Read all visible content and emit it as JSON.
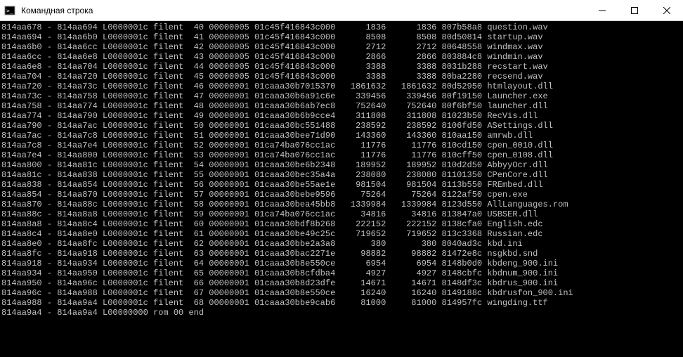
{
  "window": {
    "title": "Командная строка"
  },
  "columns": [
    "addr1",
    "sep",
    "addr2",
    "lval",
    "type",
    "n",
    "col6",
    "hash",
    "size1",
    "size2",
    "hex",
    "file"
  ],
  "rows": [
    {
      "addr1": "814aa678",
      "sep": "-",
      "addr2": "814aa694",
      "lval": "L0000001c",
      "type": "filent",
      "n": "40",
      "col6": "00000005",
      "hash": "01c45f416843c000",
      "size1": "1836",
      "size2": "1836",
      "hex": "807b58a8",
      "file": "question.wav"
    },
    {
      "addr1": "814aa694",
      "sep": "-",
      "addr2": "814aa6b0",
      "lval": "L0000001c",
      "type": "filent",
      "n": "41",
      "col6": "00000005",
      "hash": "01c45f416843c000",
      "size1": "8508",
      "size2": "8508",
      "hex": "80d50814",
      "file": "startup.wav"
    },
    {
      "addr1": "814aa6b0",
      "sep": "-",
      "addr2": "814aa6cc",
      "lval": "L0000001c",
      "type": "filent",
      "n": "42",
      "col6": "00000005",
      "hash": "01c45f416843c000",
      "size1": "2712",
      "size2": "2712",
      "hex": "80648558",
      "file": "windmax.wav"
    },
    {
      "addr1": "814aa6cc",
      "sep": "-",
      "addr2": "814aa6e8",
      "lval": "L0000001c",
      "type": "filent",
      "n": "43",
      "col6": "00000005",
      "hash": "01c45f416843c000",
      "size1": "2866",
      "size2": "2866",
      "hex": "803884c8",
      "file": "windmin.wav"
    },
    {
      "addr1": "814aa6e8",
      "sep": "-",
      "addr2": "814aa704",
      "lval": "L0000001c",
      "type": "filent",
      "n": "44",
      "col6": "00000005",
      "hash": "01c45f416843c000",
      "size1": "3388",
      "size2": "3388",
      "hex": "8031b288",
      "file": "recstart.wav"
    },
    {
      "addr1": "814aa704",
      "sep": "-",
      "addr2": "814aa720",
      "lval": "L0000001c",
      "type": "filent",
      "n": "45",
      "col6": "00000005",
      "hash": "01c45f416843c000",
      "size1": "3388",
      "size2": "3388",
      "hex": "80ba2280",
      "file": "recsend.wav"
    },
    {
      "addr1": "814aa720",
      "sep": "-",
      "addr2": "814aa73c",
      "lval": "L0000001c",
      "type": "filent",
      "n": "46",
      "col6": "00000001",
      "hash": "01caaa30b7015370",
      "size1": "1861632",
      "size2": "1861632",
      "hex": "80d52950",
      "file": "htmlayout.dll"
    },
    {
      "addr1": "814aa73c",
      "sep": "-",
      "addr2": "814aa758",
      "lval": "L0000001c",
      "type": "filent",
      "n": "47",
      "col6": "00000001",
      "hash": "01caaa30b6a91c6e",
      "size1": "339456",
      "size2": "339456",
      "hex": "80f19150",
      "file": "Launcher.exe"
    },
    {
      "addr1": "814aa758",
      "sep": "-",
      "addr2": "814aa774",
      "lval": "L0000001c",
      "type": "filent",
      "n": "48",
      "col6": "00000001",
      "hash": "01caaa30b6ab7ec8",
      "size1": "752640",
      "size2": "752640",
      "hex": "80f6bf50",
      "file": "launcher.dll"
    },
    {
      "addr1": "814aa774",
      "sep": "-",
      "addr2": "814aa790",
      "lval": "L0000001c",
      "type": "filent",
      "n": "49",
      "col6": "00000001",
      "hash": "01caaa30b6b9cce4",
      "size1": "311808",
      "size2": "311808",
      "hex": "81023b50",
      "file": "RecVis.dll"
    },
    {
      "addr1": "814aa790",
      "sep": "-",
      "addr2": "814aa7ac",
      "lval": "L0000001c",
      "type": "filent",
      "n": "50",
      "col6": "00000001",
      "hash": "01caaa30bc551488",
      "size1": "238592",
      "size2": "238592",
      "hex": "8106fd50",
      "file": "ASettings.dll"
    },
    {
      "addr1": "814aa7ac",
      "sep": "-",
      "addr2": "814aa7c8",
      "lval": "L0000001c",
      "type": "filent",
      "n": "51",
      "col6": "00000001",
      "hash": "01caaa30bee71d90",
      "size1": "143360",
      "size2": "143360",
      "hex": "810aa150",
      "file": "amrwb.dll"
    },
    {
      "addr1": "814aa7c8",
      "sep": "-",
      "addr2": "814aa7e4",
      "lval": "L0000001c",
      "type": "filent",
      "n": "52",
      "col6": "00000001",
      "hash": "01ca74ba076cc1ac",
      "size1": "11776",
      "size2": "11776",
      "hex": "810cd150",
      "file": "cpen_0010.dll"
    },
    {
      "addr1": "814aa7e4",
      "sep": "-",
      "addr2": "814aa800",
      "lval": "L0000001c",
      "type": "filent",
      "n": "53",
      "col6": "00000001",
      "hash": "01ca74ba076cc1ac",
      "size1": "11776",
      "size2": "11776",
      "hex": "810cff50",
      "file": "cpen_0108.dll"
    },
    {
      "addr1": "814aa800",
      "sep": "-",
      "addr2": "814aa81c",
      "lval": "L0000001c",
      "type": "filent",
      "n": "54",
      "col6": "00000001",
      "hash": "01caaa30be6b2348",
      "size1": "189952",
      "size2": "189952",
      "hex": "810d2d50",
      "file": "AbbyyOcr.dll"
    },
    {
      "addr1": "814aa81c",
      "sep": "-",
      "addr2": "814aa838",
      "lval": "L0000001c",
      "type": "filent",
      "n": "55",
      "col6": "00000001",
      "hash": "01caaa30bec35a4a",
      "size1": "238080",
      "size2": "238080",
      "hex": "81101350",
      "file": "CPenCore.dll"
    },
    {
      "addr1": "814aa838",
      "sep": "-",
      "addr2": "814aa854",
      "lval": "L0000001c",
      "type": "filent",
      "n": "56",
      "col6": "00000001",
      "hash": "01caaa30be55ae1e",
      "size1": "981504",
      "size2": "981504",
      "hex": "8113b550",
      "file": "FREmbed.dll"
    },
    {
      "addr1": "814aa854",
      "sep": "-",
      "addr2": "814aa870",
      "lval": "L0000001c",
      "type": "filent",
      "n": "57",
      "col6": "00000001",
      "hash": "01caaa30bebe9596",
      "size1": "75264",
      "size2": "75264",
      "hex": "8122af50",
      "file": "cpen.exe"
    },
    {
      "addr1": "814aa870",
      "sep": "-",
      "addr2": "814aa88c",
      "lval": "L0000001c",
      "type": "filent",
      "n": "58",
      "col6": "00000001",
      "hash": "01caaa30bea45bb8",
      "size1": "1339984",
      "size2": "1339984",
      "hex": "8123d550",
      "file": "AllLanguages.rom"
    },
    {
      "addr1": "814aa88c",
      "sep": "-",
      "addr2": "814aa8a8",
      "lval": "L0000001c",
      "type": "filent",
      "n": "59",
      "col6": "00000001",
      "hash": "01ca74ba076cc1ac",
      "size1": "34816",
      "size2": "34816",
      "hex": "813847a0",
      "file": "USBSER.dll"
    },
    {
      "addr1": "814aa8a8",
      "sep": "-",
      "addr2": "814aa8c4",
      "lval": "L0000001c",
      "type": "filent",
      "n": "60",
      "col6": "00000001",
      "hash": "01caaa30bdf8b268",
      "size1": "222152",
      "size2": "222152",
      "hex": "8138cfa0",
      "file": "English.edc"
    },
    {
      "addr1": "814aa8c4",
      "sep": "-",
      "addr2": "814aa8e0",
      "lval": "L0000001c",
      "type": "filent",
      "n": "61",
      "col6": "00000001",
      "hash": "01caaa30be49c25c",
      "size1": "719652",
      "size2": "719652",
      "hex": "813c3368",
      "file": "Russian.edc"
    },
    {
      "addr1": "814aa8e0",
      "sep": "-",
      "addr2": "814aa8fc",
      "lval": "L0000001c",
      "type": "filent",
      "n": "62",
      "col6": "00000001",
      "hash": "01caaa30bbe2a3a8",
      "size1": "380",
      "size2": "380",
      "hex": "8040ad3c",
      "file": "kbd.ini"
    },
    {
      "addr1": "814aa8fc",
      "sep": "-",
      "addr2": "814aa918",
      "lval": "L0000001c",
      "type": "filent",
      "n": "63",
      "col6": "00000001",
      "hash": "01caaa30bac2271e",
      "size1": "98882",
      "size2": "98882",
      "hex": "81472e8c",
      "file": "nsgkbd.snd"
    },
    {
      "addr1": "814aa918",
      "sep": "-",
      "addr2": "814aa934",
      "lval": "L0000001c",
      "type": "filent",
      "n": "64",
      "col6": "00000001",
      "hash": "01caaa30b8e550ce",
      "size1": "6954",
      "size2": "6954",
      "hex": "8148b0d0",
      "file": "kbdeng_900.ini"
    },
    {
      "addr1": "814aa934",
      "sep": "-",
      "addr2": "814aa950",
      "lval": "L0000001c",
      "type": "filent",
      "n": "65",
      "col6": "00000001",
      "hash": "01caaa30b8cfdba4",
      "size1": "4927",
      "size2": "4927",
      "hex": "8148cbfc",
      "file": "kbdnum_900.ini"
    },
    {
      "addr1": "814aa950",
      "sep": "-",
      "addr2": "814aa96c",
      "lval": "L0000001c",
      "type": "filent",
      "n": "66",
      "col6": "00000001",
      "hash": "01caaa30b8d23dfe",
      "size1": "14671",
      "size2": "14671",
      "hex": "8148df3c",
      "file": "kbdrus_900.ini"
    },
    {
      "addr1": "814aa96c",
      "sep": "-",
      "addr2": "814aa988",
      "lval": "L0000001c",
      "type": "filent",
      "n": "67",
      "col6": "00000001",
      "hash": "01caaa30b8e550ce",
      "size1": "16240",
      "size2": "16240",
      "hex": "8149188c",
      "file": "kbdrusfon_900.ini"
    },
    {
      "addr1": "814aa988",
      "sep": "-",
      "addr2": "814aa9a4",
      "lval": "L0000001c",
      "type": "filent",
      "n": "68",
      "col6": "00000001",
      "hash": "01caaa30bbe9cab6",
      "size1": "81000",
      "size2": "81000",
      "hex": "814957fc",
      "file": "wingding.ttf"
    }
  ],
  "tail": {
    "addr1": "814aa9a4",
    "sep": "-",
    "addr2": "814aa9a4",
    "lval": "L00000000",
    "type": "rom",
    "n": "00",
    "rest": "end"
  }
}
